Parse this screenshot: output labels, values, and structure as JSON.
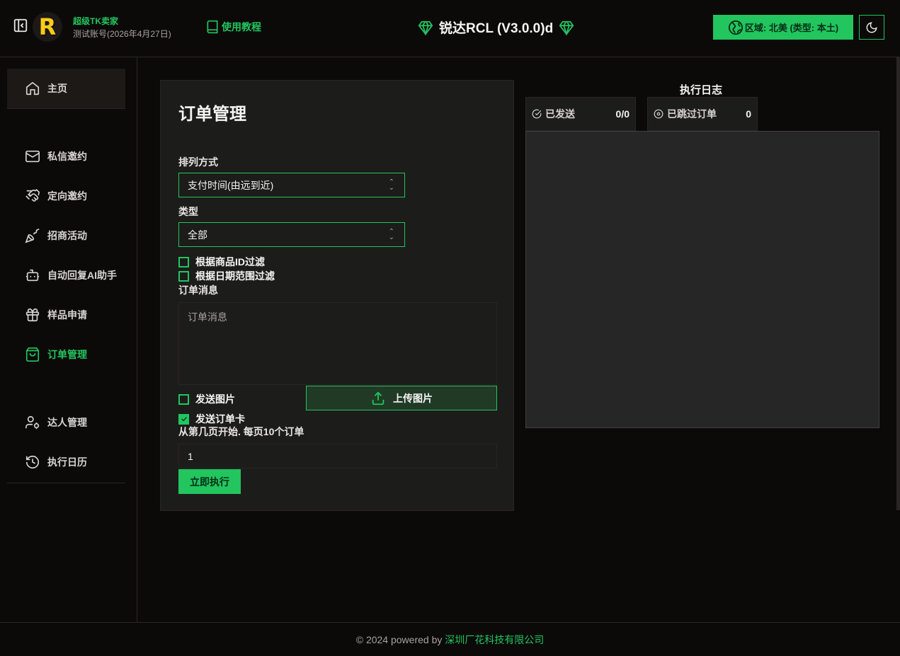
{
  "header": {
    "brand_name": "超级TK卖家",
    "account": "测试账号(2026年4月27日)",
    "logo_letter": "R",
    "tutorial_label": "使用教程",
    "app_title": "锐达RCL (V3.0.0)d",
    "region_label": "区域: 北美 (类型: 本土)"
  },
  "sidebar": {
    "home": "主页",
    "items": [
      {
        "label": "私信邀约",
        "icon": "mail-icon"
      },
      {
        "label": "定向邀约",
        "icon": "handshake-icon"
      },
      {
        "label": "招商活动",
        "icon": "party-popper-icon"
      },
      {
        "label": "自动回复AI助手",
        "icon": "bot-icon"
      },
      {
        "label": "样品申请",
        "icon": "gift-icon"
      },
      {
        "label": "订单管理",
        "icon": "shopping-bag-icon",
        "active": true
      },
      {
        "label": "达人管理",
        "icon": "user-cog-icon"
      },
      {
        "label": "执行日历",
        "icon": "history-icon"
      }
    ]
  },
  "order_panel": {
    "title": "订单管理",
    "sort_label": "排列方式",
    "sort_value": "支付时间(由远到近)",
    "type_label": "类型",
    "type_value": "全部",
    "filter_product_id": "根据商品ID过滤",
    "filter_date_range": "根据日期范围过滤",
    "message_label": "订单消息",
    "message_placeholder": "订单消息",
    "send_image_label": "发送图片",
    "upload_image_label": "上传图片",
    "send_order_card_label": "发送订单卡",
    "page_label": "从第几页开始. 每页10个订单",
    "page_value": "1",
    "run_label": "立即执行",
    "filter_product_id_checked": false,
    "filter_date_range_checked": false,
    "send_image_checked": false,
    "send_order_card_checked": true
  },
  "log": {
    "title": "执行日志",
    "sent_label": "已发送",
    "sent_value": "0/0",
    "skipped_label": "已跳过订单",
    "skipped_value": "0"
  },
  "footer": {
    "prefix": "© 2024 powered by ",
    "company": "深圳厂花科技有限公司"
  },
  "colors": {
    "accent": "#22c55e",
    "background": "#0c0a09",
    "panel": "#1c1c1b"
  }
}
